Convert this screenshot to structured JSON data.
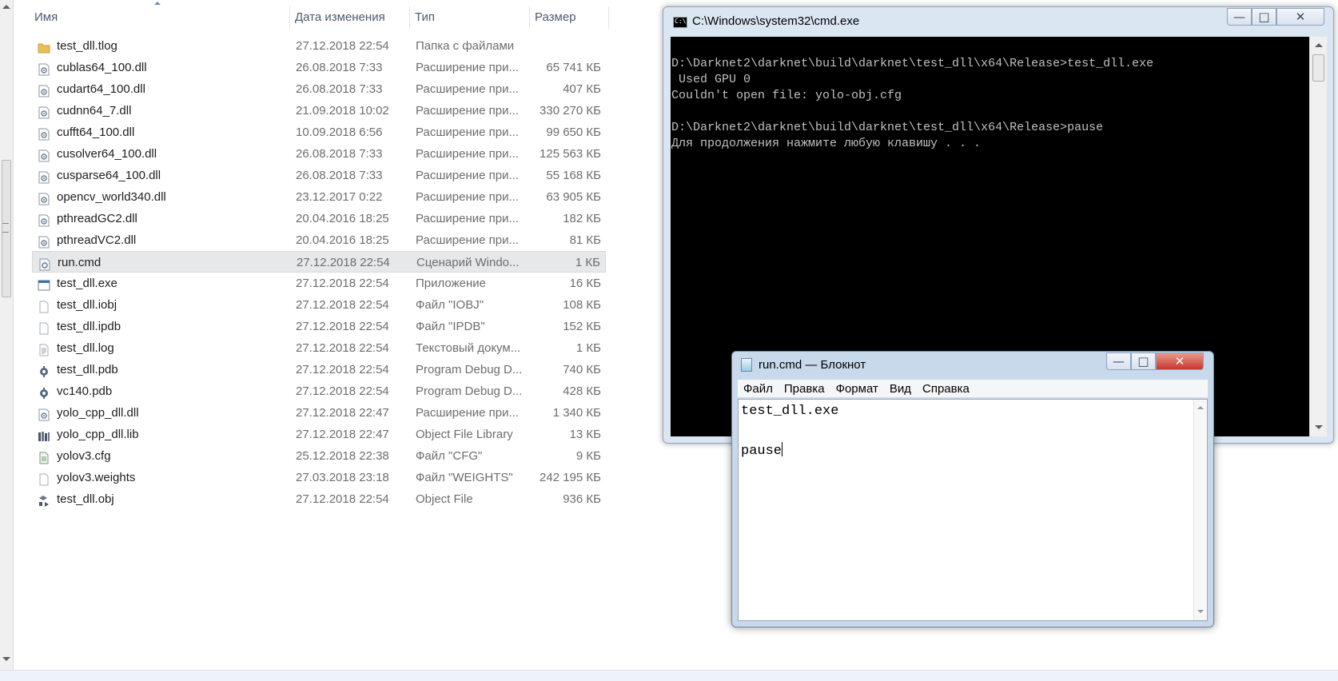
{
  "explorer": {
    "columns": {
      "name": "Имя",
      "date": "Дата изменения",
      "type": "Тип",
      "size": "Размер"
    },
    "files": [
      {
        "name": "test_dll.tlog",
        "date": "27.12.2018 22:54",
        "type": "Папка с файлами",
        "size": "",
        "icon": "folder-icon"
      },
      {
        "name": "cublas64_100.dll",
        "date": "26.08.2018 7:33",
        "type": "Расширение при...",
        "size": "65 741 КБ",
        "icon": "dll-icon"
      },
      {
        "name": "cudart64_100.dll",
        "date": "26.08.2018 7:33",
        "type": "Расширение при...",
        "size": "407 КБ",
        "icon": "dll-icon"
      },
      {
        "name": "cudnn64_7.dll",
        "date": "21.09.2018 10:02",
        "type": "Расширение при...",
        "size": "330 270 КБ",
        "icon": "dll-icon"
      },
      {
        "name": "cufft64_100.dll",
        "date": "10.09.2018 6:56",
        "type": "Расширение при...",
        "size": "99 650 КБ",
        "icon": "dll-icon"
      },
      {
        "name": "cusolver64_100.dll",
        "date": "26.08.2018 7:33",
        "type": "Расширение при...",
        "size": "125 563 КБ",
        "icon": "dll-icon"
      },
      {
        "name": "cusparse64_100.dll",
        "date": "26.08.2018 7:33",
        "type": "Расширение при...",
        "size": "55 168 КБ",
        "icon": "dll-icon"
      },
      {
        "name": "opencv_world340.dll",
        "date": "23.12.2017 0:22",
        "type": "Расширение при...",
        "size": "63 905 КБ",
        "icon": "dll-icon"
      },
      {
        "name": "pthreadGC2.dll",
        "date": "20.04.2016 18:25",
        "type": "Расширение при...",
        "size": "182 КБ",
        "icon": "dll-icon"
      },
      {
        "name": "pthreadVC2.dll",
        "date": "20.04.2016 18:25",
        "type": "Расширение при...",
        "size": "81 КБ",
        "icon": "dll-icon"
      },
      {
        "name": "run.cmd",
        "date": "27.12.2018 22:54",
        "type": "Сценарий Windo...",
        "size": "1 КБ",
        "icon": "script-icon",
        "selected": true
      },
      {
        "name": "test_dll.exe",
        "date": "27.12.2018 22:54",
        "type": "Приложение",
        "size": "16 КБ",
        "icon": "exe-icon"
      },
      {
        "name": "test_dll.iobj",
        "date": "27.12.2018 22:54",
        "type": "Файл \"IOBJ\"",
        "size": "108 КБ",
        "icon": "blank-file-icon"
      },
      {
        "name": "test_dll.ipdb",
        "date": "27.12.2018 22:54",
        "type": "Файл \"IPDB\"",
        "size": "152 КБ",
        "icon": "blank-file-icon"
      },
      {
        "name": "test_dll.log",
        "date": "27.12.2018 22:54",
        "type": "Текстовый докум...",
        "size": "1 КБ",
        "icon": "text-file-icon"
      },
      {
        "name": "test_dll.pdb",
        "date": "27.12.2018 22:54",
        "type": "Program Debug D...",
        "size": "740 КБ",
        "icon": "pdb-icon"
      },
      {
        "name": "vc140.pdb",
        "date": "27.12.2018 22:54",
        "type": "Program Debug D...",
        "size": "428 КБ",
        "icon": "pdb-icon"
      },
      {
        "name": "yolo_cpp_dll.dll",
        "date": "27.12.2018 22:47",
        "type": "Расширение при...",
        "size": "1 340 КБ",
        "icon": "dll-icon"
      },
      {
        "name": "yolo_cpp_dll.lib",
        "date": "27.12.2018 22:47",
        "type": "Object File Library",
        "size": "13 КБ",
        "icon": "lib-icon"
      },
      {
        "name": "yolov3.cfg",
        "date": "25.12.2018 22:38",
        "type": "Файл \"CFG\"",
        "size": "9 КБ",
        "icon": "cfg-icon"
      },
      {
        "name": "yolov3.weights",
        "date": "27.03.2018 23:18",
        "type": "Файл \"WEIGHTS\"",
        "size": "242 195 КБ",
        "icon": "blank-file-icon"
      },
      {
        "name": "test_dll.obj",
        "date": "27.12.2018 22:54",
        "type": "Object File",
        "size": "936 КБ",
        "icon": "obj-icon"
      }
    ]
  },
  "cmd": {
    "title": "C:\\Windows\\system32\\cmd.exe",
    "icon_label": "C:\\",
    "output": "D:\\Darknet2\\darknet\\build\\darknet\\test_dll\\x64\\Release>test_dll.exe\n Used GPU 0\nCouldn't open file: yolo-obj.cfg\n\nD:\\Darknet2\\darknet\\build\\darknet\\test_dll\\x64\\Release>pause\nДля продолжения нажмите любую клавишу . . ."
  },
  "notepad": {
    "title": "run.cmd — Блокнот",
    "menu": [
      "Файл",
      "Правка",
      "Формат",
      "Вид",
      "Справка"
    ],
    "content": "test_dll.exe\n\npause"
  },
  "window_buttons": {
    "minimize": "—",
    "maximize": "□",
    "close": "✕"
  },
  "colors": {
    "selection": "#e7e8ea",
    "console_bg": "#000000",
    "console_fg": "#c0c0c0",
    "close_button": "#c7372f"
  }
}
